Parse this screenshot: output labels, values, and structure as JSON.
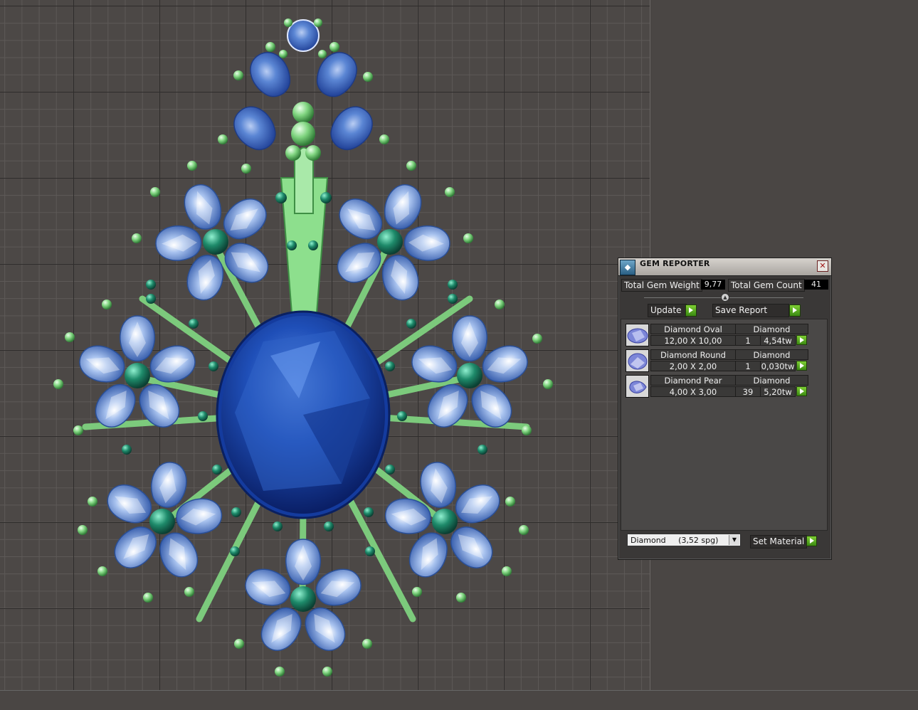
{
  "panel": {
    "title": "GEM REPORTER",
    "total_weight_label": "Total Gem Weight",
    "total_weight_value": "9,77",
    "total_count_label": "Total Gem Count",
    "total_count_value": "41",
    "update_label": "Update",
    "save_report_label": "Save Report",
    "gems": [
      {
        "name": "Diamond Oval",
        "material": "Diamond",
        "size": "12,00 X 10,00",
        "count": "1",
        "weight": "4,54tw",
        "shape": "oval"
      },
      {
        "name": "Diamond Round",
        "material": "Diamond",
        "size": "2,00 X 2,00",
        "count": "1",
        "weight": "0,030tw",
        "shape": "round"
      },
      {
        "name": "Diamond Pear",
        "material": "Diamond",
        "size": "4,00 X 3,00",
        "count": "39",
        "weight": "5,20tw",
        "shape": "pear"
      }
    ],
    "material_select_value": "Diamond     (3,52 spg)",
    "set_material_label": "Set Material"
  },
  "icons": {
    "app": "gem-reporter-icon",
    "close": "close-icon",
    "dropdown": "chevron-down-icon",
    "go": "play-arrow-icon"
  },
  "colors": {
    "gem_center": "#1a3a9a",
    "gem_petal": "#6f95d6",
    "metal": "#86d686",
    "accent_button": "#5aa623"
  }
}
